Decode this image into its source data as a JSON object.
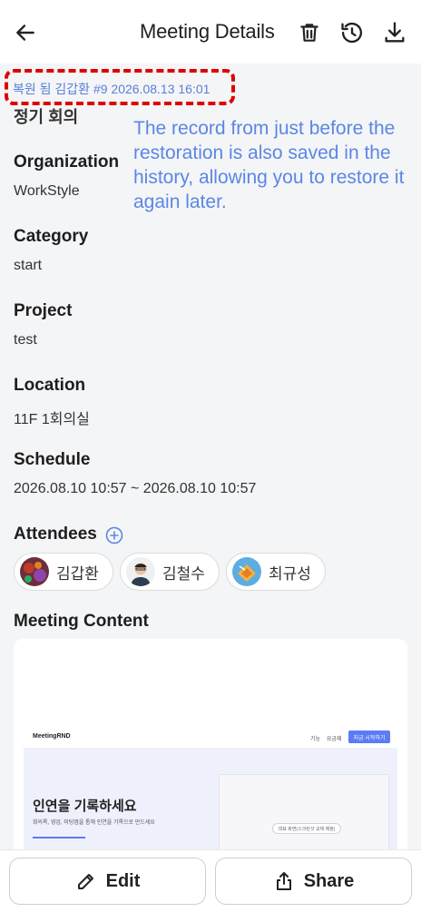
{
  "header": {
    "title": "Meeting Details"
  },
  "restore_banner": "복원 됨 김갑환 #9 2026.08.13 16:01",
  "meeting_title": "정기 회의",
  "callout": "The record from just before the restoration is also saved in the history, allowing you to restore it again later.",
  "fields": {
    "organization": {
      "label": "Organization",
      "value": "WorkStyle"
    },
    "category": {
      "label": "Category",
      "value": "start"
    },
    "project": {
      "label": "Project",
      "value": "test"
    },
    "location": {
      "label": "Location",
      "value": "11F 1회의실"
    },
    "schedule": {
      "label": "Schedule",
      "value": "2026.08.10 10:57 ~ 2026.08.10 10:57"
    }
  },
  "attendees": {
    "label": "Attendees",
    "people": [
      {
        "name": "김갑환"
      },
      {
        "name": "김철수"
      },
      {
        "name": "최규성"
      }
    ]
  },
  "meeting_content": {
    "label": "Meeting Content",
    "preview": {
      "logo": "MeetingRND",
      "menu": [
        "기능",
        "요금제"
      ],
      "cta": "지금 시작하기",
      "headline": "인연을 기록하세요",
      "subtext": "회의록, 영업, 미팅앱을 통해 인연을 기록으로 만드세요",
      "pill": "대표 화면(스크린샷 교체 예정)"
    }
  },
  "actions": {
    "edit": "Edit",
    "share": "Share"
  },
  "colors": {
    "accent": "#5b86e5",
    "highlight": "#e00000"
  }
}
